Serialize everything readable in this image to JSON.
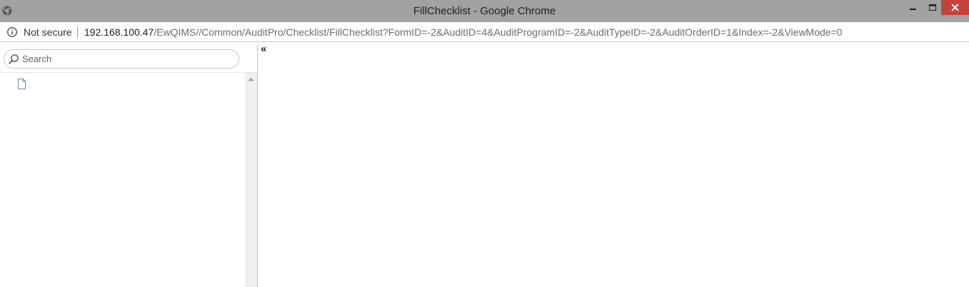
{
  "window": {
    "title": "FillChecklist - Google Chrome"
  },
  "addressbar": {
    "security_label": "Not secure",
    "url_host": "192.168.100.47",
    "url_path": "/EwQIMS//Common/AuditPro/Checklist/FillChecklist?FormID=-2&AuditID=4&AuditProgramID=-2&AuditTypeID=-2&AuditOrderID=1&Index=-2&ViewMode=0"
  },
  "sidebar": {
    "search": {
      "placeholder": "Search",
      "value": ""
    },
    "tree_items": [
      {
        "icon": "document-icon",
        "label": ""
      }
    ]
  },
  "main": {
    "collapse_label": "«"
  },
  "colors": {
    "titlebar": "#a2a2a2",
    "close_button": "#c7413b",
    "panel_border": "#a9c7e0"
  }
}
